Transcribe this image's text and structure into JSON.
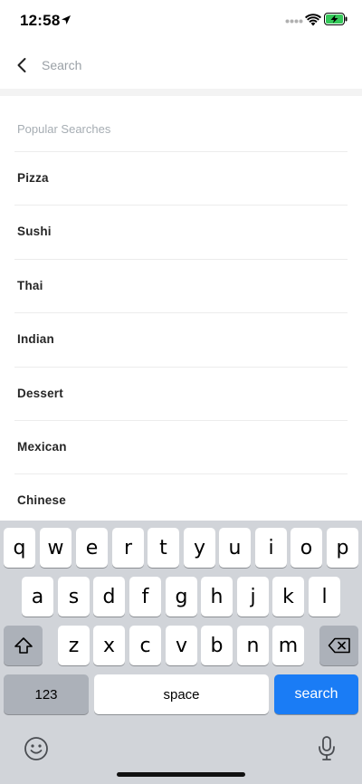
{
  "status_bar": {
    "time": "12:58",
    "icons": [
      "location-arrow-icon",
      "signal-dots-icon",
      "wifi-icon",
      "battery-charging-icon"
    ],
    "battery_color": "#34c759"
  },
  "search": {
    "placeholder": "Search",
    "value": ""
  },
  "popular": {
    "heading": "Popular Searches",
    "items": [
      "Pizza",
      "Sushi",
      "Thai",
      "Indian",
      "Dessert",
      "Mexican",
      "Chinese"
    ]
  },
  "keyboard": {
    "row1": [
      "q",
      "w",
      "e",
      "r",
      "t",
      "y",
      "u",
      "i",
      "o",
      "p"
    ],
    "row2": [
      "a",
      "s",
      "d",
      "f",
      "g",
      "h",
      "j",
      "k",
      "l"
    ],
    "row3": [
      "z",
      "x",
      "c",
      "v",
      "b",
      "n",
      "m"
    ],
    "numbers_label": "123",
    "space_label": "space",
    "search_label": "search",
    "accent_color": "#1a7cf5"
  }
}
